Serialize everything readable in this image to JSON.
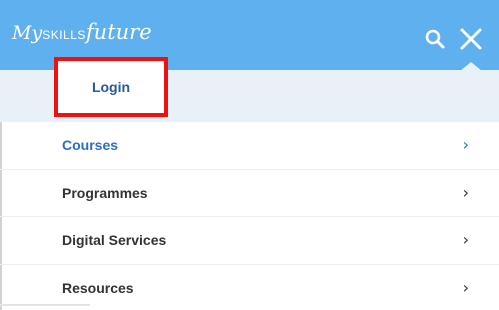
{
  "brand": {
    "my": "My",
    "skills": "SKILLS",
    "future": "future"
  },
  "header": {
    "search_icon": "search-icon",
    "close_icon": "close-icon"
  },
  "login": {
    "label": "Login"
  },
  "menu": {
    "items": [
      {
        "label": "Courses",
        "active": true,
        "color": "#2a6fc3"
      },
      {
        "label": "Programmes",
        "active": false
      },
      {
        "label": "Digital Services",
        "active": false
      },
      {
        "label": "Resources",
        "active": false
      }
    ],
    "chevron": "›"
  },
  "colors": {
    "header_bg": "#5eb0ee",
    "login_bar_bg": "#e9f1f8",
    "highlight": "#ee1111",
    "link": "#245b9c"
  }
}
